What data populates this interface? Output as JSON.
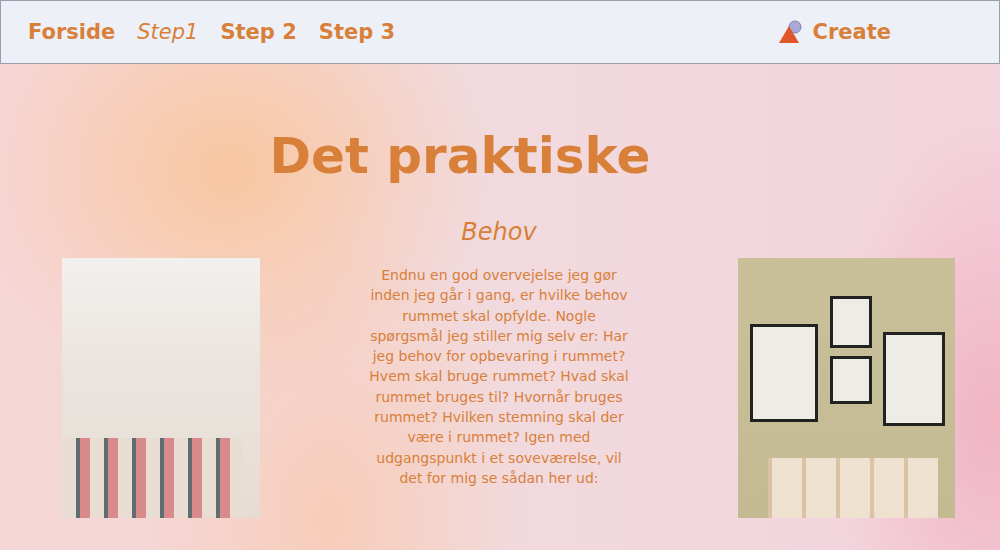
{
  "nav": {
    "items": [
      {
        "label": "Forside",
        "selected": false
      },
      {
        "label": "Step1",
        "selected": true
      },
      {
        "label": "Step 2",
        "selected": false
      },
      {
        "label": "Step 3",
        "selected": false
      }
    ],
    "brand": "Create"
  },
  "page": {
    "title": "Det praktiske",
    "subtitle": "Behov",
    "body": "Endnu en god overvejelse jeg gør inden jeg går i gang, er hvilke behov rummet skal opfylde. Nogle spørgsmål jeg stiller mig selv er: Har jeg behov for opbevaring i rummet? Hvem skal bruge rummet? Hvad skal rummet bruges til? Hvornår bruges rummet? Hvilken stemning skal der være i rummet? Igen med udgangspunkt i et soveværelse, vil det for mig se sådan her ud:"
  }
}
